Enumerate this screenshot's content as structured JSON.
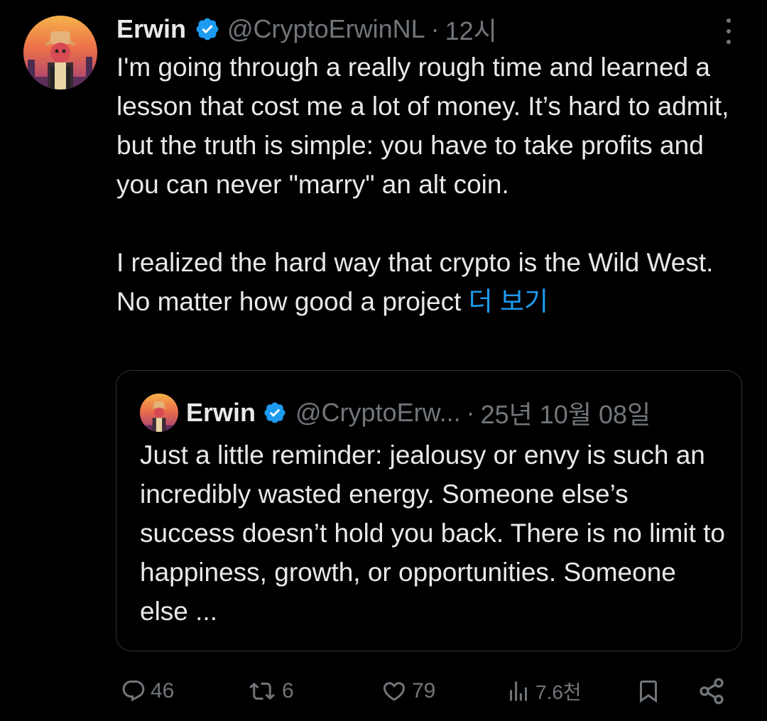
{
  "tweet": {
    "author_name": "Erwin",
    "handle": "@CryptoErwinNL",
    "separator": "·",
    "time": "12시",
    "text_paragraph_1": "I'm going through a really rough time and learned a lesson that cost me a lot of money. It’s hard to admit, but the truth is simple: you have to take profits and you can never \"marry\" an alt coin.",
    "text_paragraph_2": "I realized the hard way that crypto is the Wild West. No matter how good a project",
    "show_more_label": "더 보기"
  },
  "quoted_tweet": {
    "author_name": "Erwin",
    "handle": "@CryptoErw...",
    "separator": "·",
    "time": "25년 10월 08일",
    "text": "Just a little reminder: jealousy or envy is such an incredibly wasted energy. Someone else’s success doesn’t hold you back. There is no limit to happiness, growth, or opportunities. Someone else ..."
  },
  "actions": {
    "replies": "46",
    "reposts": "6",
    "likes": "79",
    "views": "7.6천"
  },
  "icons": {
    "verified": "verified-badge-icon",
    "more": "more-vertical-icon",
    "reply": "reply-icon",
    "repost": "repost-icon",
    "like": "heart-icon",
    "views": "views-chart-icon",
    "bookmark": "bookmark-icon",
    "share": "share-icon"
  },
  "colors": {
    "background": "#000000",
    "text": "#e7e9ea",
    "secondary": "#71767b",
    "accent": "#1d9bf0",
    "border": "#2f3336"
  }
}
